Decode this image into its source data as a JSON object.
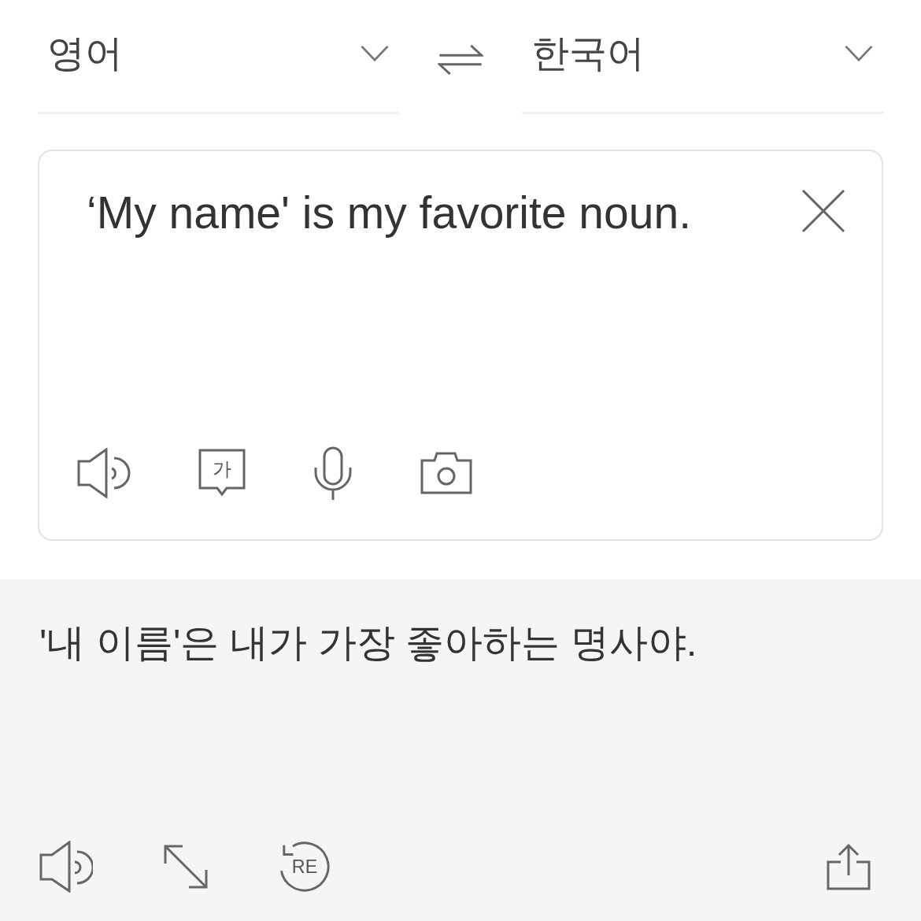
{
  "source_language": {
    "label": "영어"
  },
  "target_language": {
    "label": "한국어"
  },
  "input": {
    "value": "‘My name' is my favorite noun."
  },
  "input_tools": [
    {
      "kind": "speaker"
    },
    {
      "kind": "handwriting",
      "glyph": "가"
    },
    {
      "kind": "microphone"
    },
    {
      "kind": "camera"
    }
  ],
  "translation": {
    "text": "'내 이름'은 내가 가장 좋아하는 명사야."
  },
  "output_tools": [
    {
      "kind": "speaker"
    },
    {
      "kind": "expand"
    },
    {
      "kind": "retranslate",
      "glyph": "RE"
    },
    {
      "kind": "share"
    }
  ]
}
